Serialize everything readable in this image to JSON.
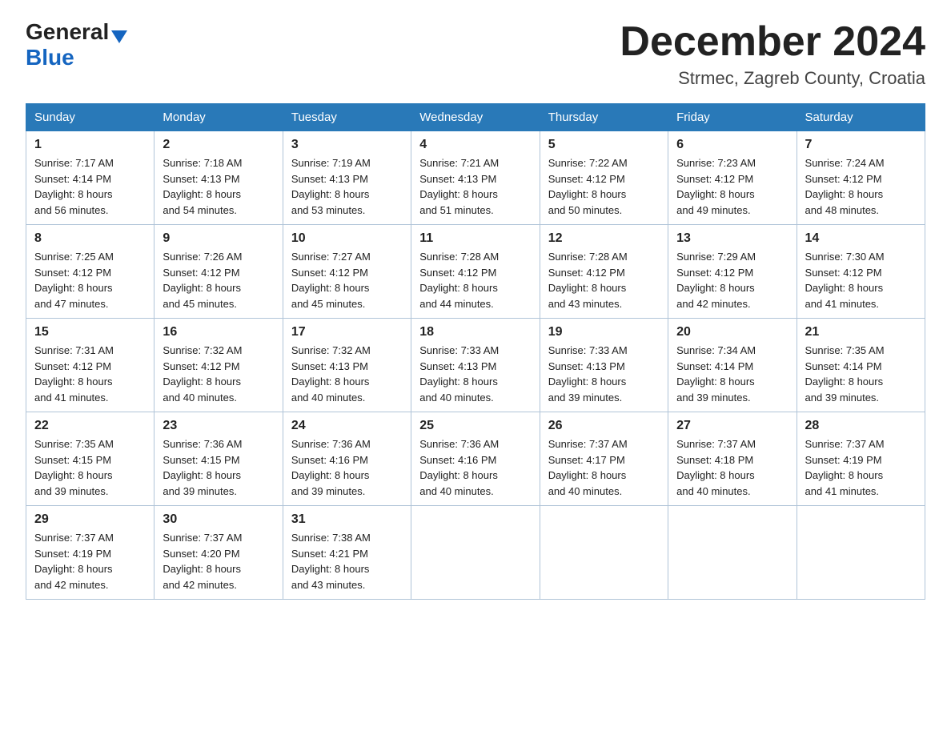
{
  "logo": {
    "general": "General",
    "blue": "Blue"
  },
  "title": "December 2024",
  "location": "Strmec, Zagreb County, Croatia",
  "days_of_week": [
    "Sunday",
    "Monday",
    "Tuesday",
    "Wednesday",
    "Thursday",
    "Friday",
    "Saturday"
  ],
  "weeks": [
    [
      {
        "day": "1",
        "sunrise": "7:17 AM",
        "sunset": "4:14 PM",
        "daylight": "8 hours and 56 minutes."
      },
      {
        "day": "2",
        "sunrise": "7:18 AM",
        "sunset": "4:13 PM",
        "daylight": "8 hours and 54 minutes."
      },
      {
        "day": "3",
        "sunrise": "7:19 AM",
        "sunset": "4:13 PM",
        "daylight": "8 hours and 53 minutes."
      },
      {
        "day": "4",
        "sunrise": "7:21 AM",
        "sunset": "4:13 PM",
        "daylight": "8 hours and 51 minutes."
      },
      {
        "day": "5",
        "sunrise": "7:22 AM",
        "sunset": "4:12 PM",
        "daylight": "8 hours and 50 minutes."
      },
      {
        "day": "6",
        "sunrise": "7:23 AM",
        "sunset": "4:12 PM",
        "daylight": "8 hours and 49 minutes."
      },
      {
        "day": "7",
        "sunrise": "7:24 AM",
        "sunset": "4:12 PM",
        "daylight": "8 hours and 48 minutes."
      }
    ],
    [
      {
        "day": "8",
        "sunrise": "7:25 AM",
        "sunset": "4:12 PM",
        "daylight": "8 hours and 47 minutes."
      },
      {
        "day": "9",
        "sunrise": "7:26 AM",
        "sunset": "4:12 PM",
        "daylight": "8 hours and 45 minutes."
      },
      {
        "day": "10",
        "sunrise": "7:27 AM",
        "sunset": "4:12 PM",
        "daylight": "8 hours and 45 minutes."
      },
      {
        "day": "11",
        "sunrise": "7:28 AM",
        "sunset": "4:12 PM",
        "daylight": "8 hours and 44 minutes."
      },
      {
        "day": "12",
        "sunrise": "7:28 AM",
        "sunset": "4:12 PM",
        "daylight": "8 hours and 43 minutes."
      },
      {
        "day": "13",
        "sunrise": "7:29 AM",
        "sunset": "4:12 PM",
        "daylight": "8 hours and 42 minutes."
      },
      {
        "day": "14",
        "sunrise": "7:30 AM",
        "sunset": "4:12 PM",
        "daylight": "8 hours and 41 minutes."
      }
    ],
    [
      {
        "day": "15",
        "sunrise": "7:31 AM",
        "sunset": "4:12 PM",
        "daylight": "8 hours and 41 minutes."
      },
      {
        "day": "16",
        "sunrise": "7:32 AM",
        "sunset": "4:12 PM",
        "daylight": "8 hours and 40 minutes."
      },
      {
        "day": "17",
        "sunrise": "7:32 AM",
        "sunset": "4:13 PM",
        "daylight": "8 hours and 40 minutes."
      },
      {
        "day": "18",
        "sunrise": "7:33 AM",
        "sunset": "4:13 PM",
        "daylight": "8 hours and 40 minutes."
      },
      {
        "day": "19",
        "sunrise": "7:33 AM",
        "sunset": "4:13 PM",
        "daylight": "8 hours and 39 minutes."
      },
      {
        "day": "20",
        "sunrise": "7:34 AM",
        "sunset": "4:14 PM",
        "daylight": "8 hours and 39 minutes."
      },
      {
        "day": "21",
        "sunrise": "7:35 AM",
        "sunset": "4:14 PM",
        "daylight": "8 hours and 39 minutes."
      }
    ],
    [
      {
        "day": "22",
        "sunrise": "7:35 AM",
        "sunset": "4:15 PM",
        "daylight": "8 hours and 39 minutes."
      },
      {
        "day": "23",
        "sunrise": "7:36 AM",
        "sunset": "4:15 PM",
        "daylight": "8 hours and 39 minutes."
      },
      {
        "day": "24",
        "sunrise": "7:36 AM",
        "sunset": "4:16 PM",
        "daylight": "8 hours and 39 minutes."
      },
      {
        "day": "25",
        "sunrise": "7:36 AM",
        "sunset": "4:16 PM",
        "daylight": "8 hours and 40 minutes."
      },
      {
        "day": "26",
        "sunrise": "7:37 AM",
        "sunset": "4:17 PM",
        "daylight": "8 hours and 40 minutes."
      },
      {
        "day": "27",
        "sunrise": "7:37 AM",
        "sunset": "4:18 PM",
        "daylight": "8 hours and 40 minutes."
      },
      {
        "day": "28",
        "sunrise": "7:37 AM",
        "sunset": "4:19 PM",
        "daylight": "8 hours and 41 minutes."
      }
    ],
    [
      {
        "day": "29",
        "sunrise": "7:37 AM",
        "sunset": "4:19 PM",
        "daylight": "8 hours and 42 minutes."
      },
      {
        "day": "30",
        "sunrise": "7:37 AM",
        "sunset": "4:20 PM",
        "daylight": "8 hours and 42 minutes."
      },
      {
        "day": "31",
        "sunrise": "7:38 AM",
        "sunset": "4:21 PM",
        "daylight": "8 hours and 43 minutes."
      },
      null,
      null,
      null,
      null
    ]
  ],
  "labels": {
    "sunrise": "Sunrise: ",
    "sunset": "Sunset: ",
    "daylight": "Daylight: "
  }
}
